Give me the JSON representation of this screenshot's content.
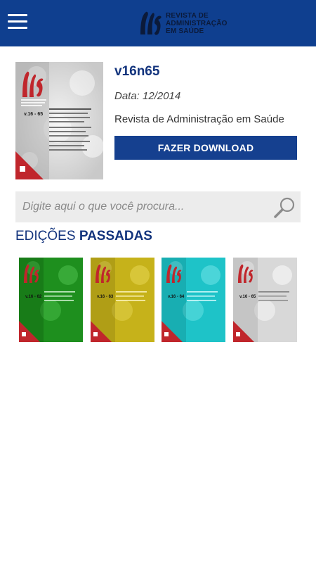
{
  "header": {
    "menu_icon": "hamburger-icon",
    "logo_text": [
      "REVISTA DE",
      "ADMINISTRAÇÃO",
      "EM SAÚDE"
    ],
    "background": "#0f3f8f"
  },
  "featured": {
    "title": "v16n65",
    "date": "Data: 12/2014",
    "journal": "Revista de Administração em Saúde",
    "download_label": "FAZER DOWNLOAD",
    "cover_issue": "v.16 - 65"
  },
  "search": {
    "placeholder": "Digite aqui o que você procura...",
    "icon": "magnifier-icon"
  },
  "past_editions": {
    "title_part1": "EDIÇÕES",
    "title_part2": "PASSADAS",
    "items": [
      {
        "issue": "v.16 - 62",
        "tint": "#1e8f1e"
      },
      {
        "issue": "v.16 - 63",
        "tint": "#c6b21a"
      },
      {
        "issue": "v.16 - 64",
        "tint": "#1ec3c8"
      },
      {
        "issue": "v.16 - 65",
        "tint": "#d8d8d8"
      }
    ]
  },
  "colors": {
    "brand_blue": "#13347d",
    "button_blue": "#15408f",
    "cover_red": "#c0262c"
  }
}
